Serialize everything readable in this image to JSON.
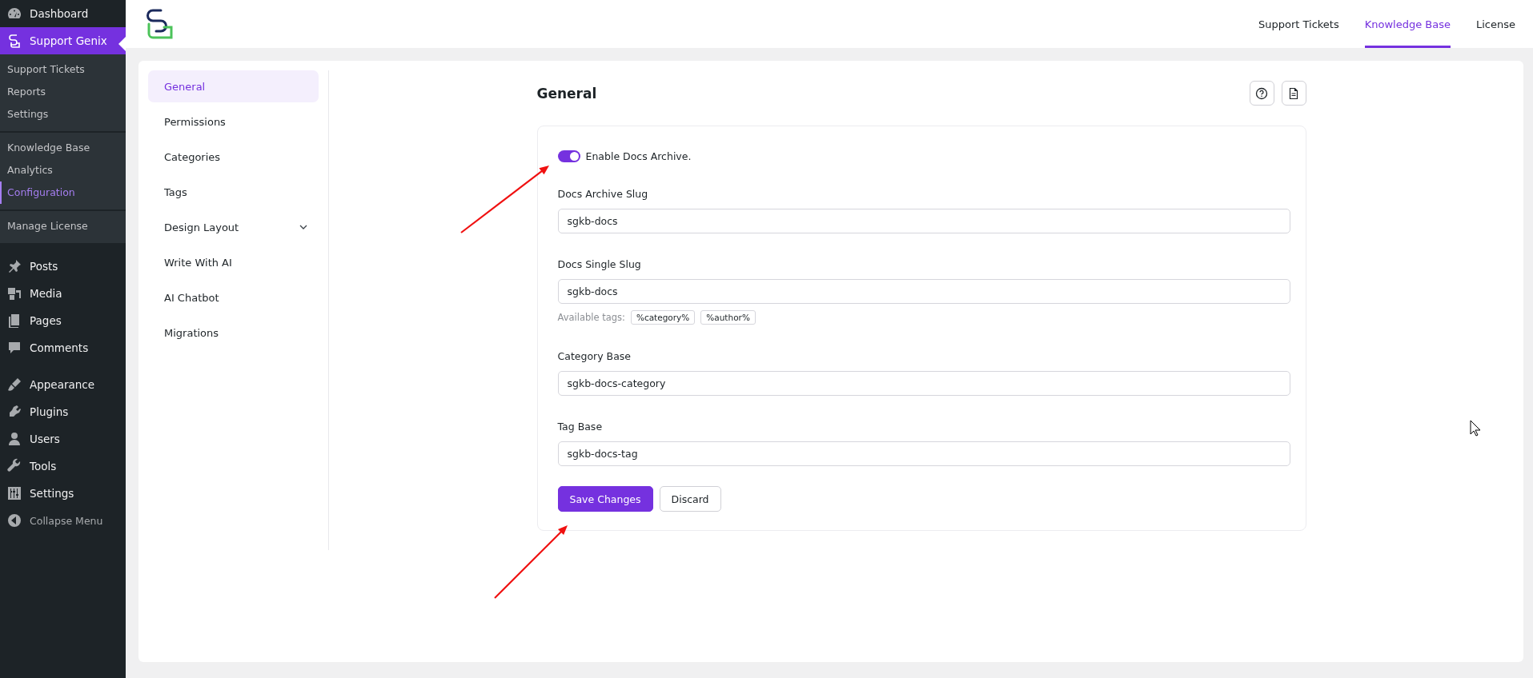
{
  "admin_menu": {
    "sections": [
      {
        "items": [
          {
            "label": "Dashboard",
            "selected": false
          },
          {
            "label": "Support Genix",
            "selected": true,
            "submenu": [
              {
                "items": [
                  {
                    "label": "Support Tickets",
                    "selected": false
                  },
                  {
                    "label": "Reports",
                    "selected": false
                  },
                  {
                    "label": "Settings",
                    "selected": false
                  }
                ]
              },
              {
                "items": [
                  {
                    "label": "Knowledge Base",
                    "selected": false
                  },
                  {
                    "label": "Analytics",
                    "selected": false
                  },
                  {
                    "label": "Configuration",
                    "selected": true
                  }
                ]
              },
              {
                "items": [
                  {
                    "label": "Manage License",
                    "selected": false
                  }
                ]
              }
            ]
          }
        ]
      },
      {
        "items": [
          {
            "label": "Posts",
            "selected": false
          },
          {
            "label": "Media",
            "selected": false
          },
          {
            "label": "Pages",
            "selected": false
          },
          {
            "label": "Comments",
            "selected": false
          }
        ]
      },
      {
        "items": [
          {
            "label": "Appearance",
            "selected": false
          },
          {
            "label": "Plugins",
            "selected": false
          },
          {
            "label": "Users",
            "selected": false
          },
          {
            "label": "Tools",
            "selected": false
          },
          {
            "label": "Settings",
            "selected": false
          }
        ]
      }
    ],
    "collapse_label": "Collapse Menu"
  },
  "header": {
    "tabs": [
      {
        "label": "Support Tickets",
        "selected": false
      },
      {
        "label": "Knowledge Base",
        "selected": true
      },
      {
        "label": "License",
        "selected": false
      }
    ]
  },
  "settings_nav": {
    "items": [
      {
        "label": "General",
        "selected": true
      },
      {
        "label": "Permissions",
        "selected": false
      },
      {
        "label": "Categories",
        "selected": false
      },
      {
        "label": "Tags",
        "selected": false
      },
      {
        "label": "Design Layout",
        "selected": false,
        "expanded": false
      },
      {
        "label": "Write With AI",
        "selected": false
      },
      {
        "label": "AI Chatbot",
        "selected": false
      },
      {
        "label": "Migrations",
        "selected": false
      }
    ]
  },
  "form": {
    "title": "General",
    "toggle": {
      "label": "Enable Docs Archive.",
      "on": true
    },
    "fields": [
      {
        "label": "Docs Archive Slug",
        "value": "sgkb-docs"
      },
      {
        "label": "Docs Single Slug",
        "value": "sgkb-docs",
        "hint_label": "Available tags:",
        "tags": [
          "%category%",
          "%author%"
        ]
      },
      {
        "label": "Category Base",
        "value": "sgkb-docs-category"
      },
      {
        "label": "Tag Base",
        "value": "sgkb-docs-tag"
      }
    ],
    "buttons": [
      {
        "label": "Save Changes",
        "kind": "primary"
      },
      {
        "label": "Discard",
        "kind": "secondary"
      }
    ]
  }
}
